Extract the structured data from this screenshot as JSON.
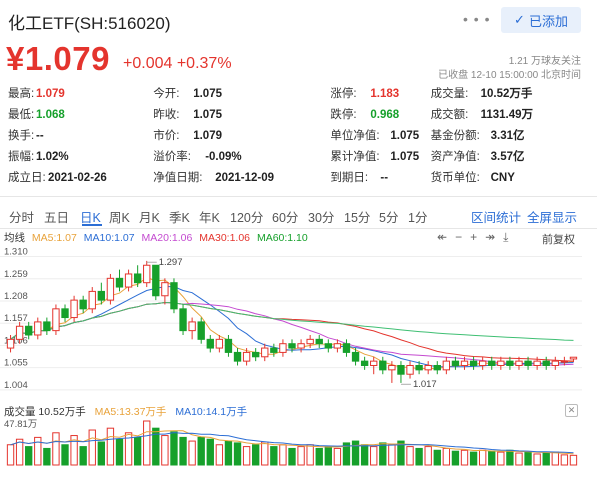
{
  "header": {
    "title": "化工ETF(SH:516020)",
    "more_label": "• • •",
    "add_label": "已添加",
    "price": "¥1.079",
    "change": "+0.004  +0.37%",
    "followers": "1.21 万球友关注",
    "close_time": "已收盘 12-10 15:00:00 北京时间"
  },
  "stats": {
    "row1": [
      {
        "label": "最高:",
        "value": "1.079",
        "color": "red"
      },
      {
        "label": "今开:",
        "value": "1.075",
        "color": ""
      },
      {
        "label": "涨停:",
        "value": "1.183",
        "color": "red"
      },
      {
        "label": "成交量:",
        "value": "10.52万手",
        "color": ""
      }
    ],
    "row2": [
      {
        "label": "最低:",
        "value": "1.068",
        "color": "green"
      },
      {
        "label": "昨收:",
        "value": "1.075",
        "color": ""
      },
      {
        "label": "跌停:",
        "value": "0.968",
        "color": "green"
      },
      {
        "label": "成交额:",
        "value": "1131.49万",
        "color": ""
      }
    ],
    "row3": [
      {
        "label": "换手:",
        "value": "--",
        "color": ""
      },
      {
        "label": "市价:",
        "value": "1.079",
        "color": ""
      },
      {
        "label": "单位净值:",
        "value": "1.075",
        "color": ""
      },
      {
        "label": "基金份额:",
        "value": "3.31亿",
        "color": ""
      }
    ],
    "row4": [
      {
        "label": "振幅:",
        "value": "1.02%",
        "color": ""
      },
      {
        "label": "溢价率:",
        "value": "-0.09%",
        "color": ""
      },
      {
        "label": "累计净值:",
        "value": "1.075",
        "color": ""
      },
      {
        "label": "资产净值:",
        "value": "3.57亿",
        "color": ""
      }
    ],
    "row5": [
      {
        "label": "成立日:",
        "value": "2021-02-26",
        "color": ""
      },
      {
        "label": "净值日期:",
        "value": "2021-12-09",
        "color": ""
      },
      {
        "label": "到期日:",
        "value": "--",
        "color": ""
      },
      {
        "label": "货币单位:",
        "value": "CNY",
        "color": ""
      }
    ]
  },
  "tabs": [
    "分时",
    "五日",
    "日K",
    "周K",
    "月K",
    "季K",
    "年K",
    "120分",
    "60分",
    "30分",
    "15分",
    "5分",
    "1分"
  ],
  "links": {
    "interval": "区间统计",
    "fullscreen": "全屏显示"
  },
  "ma_legend": {
    "prefix": "均线",
    "ma5": "MA5:1.07",
    "ma10": "MA10:1.07",
    "ma20": "MA20:1.06",
    "ma30": "MA30:1.06",
    "ma60": "MA60:1.10"
  },
  "tools": {
    "adj": "前复权"
  },
  "colors": {
    "up": "#e4342d",
    "down": "#16a02b",
    "ma5": "#e8a23a",
    "ma10": "#2c6ed5",
    "ma20": "#c44ad0",
    "ma30": "#e4342d",
    "ma60": "#3fbf73"
  },
  "vol_legend": {
    "vol": "成交量 10.52万手",
    "ma5": "MA5:13.37万手",
    "ma10": "MA10:14.1万手"
  },
  "chart_data": {
    "type": "candlestick",
    "y_ticks": [
      "1.310",
      "1.259",
      "1.208",
      "1.157",
      "1.106",
      "1.055",
      "1.004"
    ],
    "ylim": [
      0.99,
      1.325
    ],
    "annotations": [
      {
        "label": "1.297",
        "index": 15
      },
      {
        "label": "1.017",
        "index": 43
      }
    ],
    "vol_max_label": "47.81万",
    "candles": [
      [
        1.1,
        1.12,
        1.13,
        1.09
      ],
      [
        1.12,
        1.15,
        1.16,
        1.11
      ],
      [
        1.15,
        1.13,
        1.16,
        1.12
      ],
      [
        1.13,
        1.16,
        1.17,
        1.12
      ],
      [
        1.16,
        1.14,
        1.17,
        1.13
      ],
      [
        1.14,
        1.19,
        1.2,
        1.13
      ],
      [
        1.19,
        1.17,
        1.2,
        1.16
      ],
      [
        1.17,
        1.21,
        1.22,
        1.16
      ],
      [
        1.21,
        1.19,
        1.22,
        1.18
      ],
      [
        1.19,
        1.23,
        1.24,
        1.18
      ],
      [
        1.23,
        1.21,
        1.25,
        1.2
      ],
      [
        1.21,
        1.26,
        1.27,
        1.2
      ],
      [
        1.26,
        1.24,
        1.28,
        1.23
      ],
      [
        1.24,
        1.27,
        1.28,
        1.23
      ],
      [
        1.27,
        1.25,
        1.29,
        1.24
      ],
      [
        1.25,
        1.29,
        1.3,
        1.24
      ],
      [
        1.29,
        1.22,
        1.29,
        1.21
      ],
      [
        1.22,
        1.25,
        1.26,
        1.2
      ],
      [
        1.25,
        1.19,
        1.26,
        1.18
      ],
      [
        1.19,
        1.14,
        1.2,
        1.13
      ],
      [
        1.14,
        1.16,
        1.17,
        1.12
      ],
      [
        1.16,
        1.12,
        1.17,
        1.11
      ],
      [
        1.12,
        1.1,
        1.13,
        1.09
      ],
      [
        1.1,
        1.12,
        1.13,
        1.09
      ],
      [
        1.12,
        1.09,
        1.13,
        1.08
      ],
      [
        1.09,
        1.07,
        1.1,
        1.06
      ],
      [
        1.07,
        1.09,
        1.1,
        1.06
      ],
      [
        1.09,
        1.08,
        1.1,
        1.07
      ],
      [
        1.08,
        1.1,
        1.11,
        1.07
      ],
      [
        1.1,
        1.09,
        1.11,
        1.08
      ],
      [
        1.09,
        1.11,
        1.12,
        1.08
      ],
      [
        1.11,
        1.1,
        1.12,
        1.09
      ],
      [
        1.1,
        1.11,
        1.12,
        1.09
      ],
      [
        1.11,
        1.12,
        1.13,
        1.1
      ],
      [
        1.12,
        1.11,
        1.13,
        1.1
      ],
      [
        1.11,
        1.1,
        1.12,
        1.09
      ],
      [
        1.1,
        1.11,
        1.12,
        1.09
      ],
      [
        1.11,
        1.09,
        1.12,
        1.08
      ],
      [
        1.09,
        1.07,
        1.1,
        1.06
      ],
      [
        1.07,
        1.06,
        1.08,
        1.05
      ],
      [
        1.06,
        1.07,
        1.08,
        1.04
      ],
      [
        1.07,
        1.05,
        1.08,
        1.04
      ],
      [
        1.05,
        1.06,
        1.07,
        1.02
      ],
      [
        1.06,
        1.04,
        1.07,
        1.02
      ],
      [
        1.04,
        1.06,
        1.07,
        1.03
      ],
      [
        1.06,
        1.05,
        1.07,
        1.04
      ],
      [
        1.05,
        1.06,
        1.07,
        1.04
      ],
      [
        1.06,
        1.05,
        1.07,
        1.04
      ],
      [
        1.05,
        1.07,
        1.08,
        1.04
      ],
      [
        1.07,
        1.06,
        1.08,
        1.05
      ],
      [
        1.06,
        1.07,
        1.08,
        1.05
      ],
      [
        1.07,
        1.06,
        1.08,
        1.05
      ],
      [
        1.06,
        1.07,
        1.08,
        1.05
      ],
      [
        1.07,
        1.06,
        1.08,
        1.05
      ],
      [
        1.06,
        1.07,
        1.08,
        1.05
      ],
      [
        1.07,
        1.06,
        1.08,
        1.05
      ],
      [
        1.06,
        1.07,
        1.08,
        1.05
      ],
      [
        1.07,
        1.06,
        1.08,
        1.05
      ],
      [
        1.06,
        1.07,
        1.08,
        1.05
      ],
      [
        1.07,
        1.06,
        1.08,
        1.05
      ],
      [
        1.06,
        1.07,
        1.08,
        1.05
      ],
      [
        1.07,
        1.07,
        1.08,
        1.06
      ],
      [
        1.075,
        1.079,
        1.079,
        1.068
      ]
    ],
    "volumes": [
      22,
      28,
      20,
      30,
      18,
      35,
      22,
      32,
      20,
      38,
      25,
      40,
      28,
      35,
      30,
      47.8,
      40,
      32,
      36,
      30,
      26,
      30,
      28,
      22,
      26,
      24,
      20,
      22,
      25,
      20,
      22,
      18,
      20,
      22,
      18,
      20,
      18,
      24,
      26,
      22,
      20,
      24,
      22,
      26,
      20,
      18,
      20,
      16,
      18,
      15,
      16,
      14,
      16,
      15,
      14,
      16,
      13,
      14,
      12,
      13,
      14,
      11,
      10.5
    ]
  }
}
